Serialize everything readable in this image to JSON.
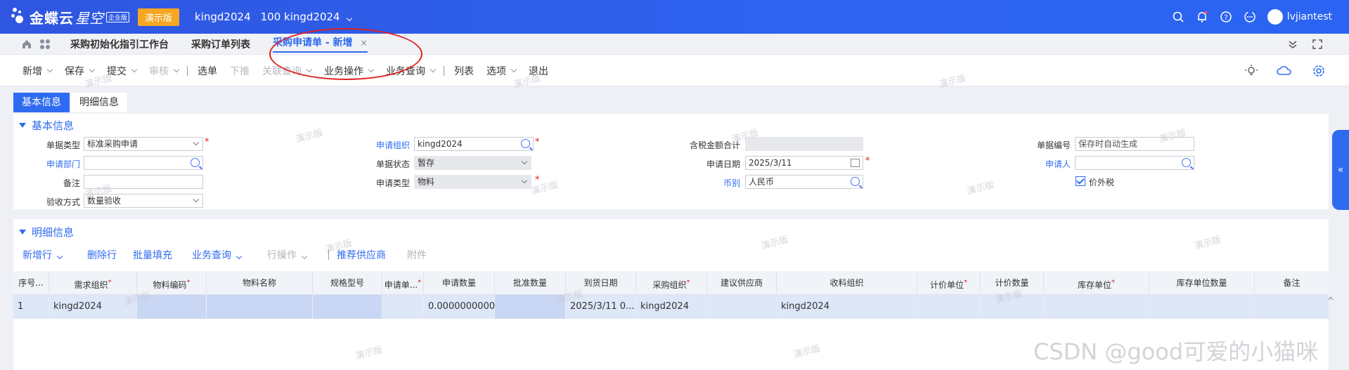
{
  "topbar": {
    "logo_main": "金蝶云",
    "logo_sub": "星空",
    "edition_badge": "企业版",
    "demo_badge": "演示版",
    "org": "kingd2024",
    "org_full": "100 kingd2024",
    "username": "lvjiantest"
  },
  "tabs": [
    {
      "label": "采购初始化指引工作台"
    },
    {
      "label": "采购订单列表"
    },
    {
      "label": "采购申请单 - 新增"
    }
  ],
  "toolbar": [
    {
      "label": "新增",
      "dropdown": true,
      "disabled": false
    },
    {
      "label": "保存",
      "dropdown": true,
      "disabled": false
    },
    {
      "label": "提交",
      "dropdown": true,
      "disabled": false
    },
    {
      "label": "审核",
      "dropdown": true,
      "disabled": true
    },
    {
      "label": "选单",
      "dropdown": false,
      "disabled": false
    },
    {
      "label": "下推",
      "dropdown": false,
      "disabled": true
    },
    {
      "label": "关联查询",
      "dropdown": true,
      "disabled": true
    },
    {
      "label": "业务操作",
      "dropdown": true,
      "disabled": false
    },
    {
      "label": "业务查询",
      "dropdown": true,
      "disabled": false
    },
    {
      "label": "列表",
      "dropdown": false,
      "disabled": false
    },
    {
      "label": "选项",
      "dropdown": true,
      "disabled": false
    },
    {
      "label": "退出",
      "dropdown": false,
      "disabled": false
    }
  ],
  "subtabs": {
    "basic": "基本信息",
    "detail": "明细信息"
  },
  "basic": {
    "title": "基本信息",
    "bill_type": {
      "label": "单据类型",
      "value": "标准采购申请"
    },
    "apply_dept": {
      "label": "申请部门",
      "value": ""
    },
    "remark": {
      "label": "备注",
      "value": ""
    },
    "accept_method": {
      "label": "验收方式",
      "value": "数量验收"
    },
    "apply_org": {
      "label": "申请组织",
      "value": "kingd2024"
    },
    "bill_status": {
      "label": "单据状态",
      "value": "暂存"
    },
    "apply_type": {
      "label": "申请类型",
      "value": "物料"
    },
    "tax_total": {
      "label": "含税金额合计",
      "value": ""
    },
    "apply_date": {
      "label": "申请日期",
      "value": "2025/3/11"
    },
    "currency": {
      "label": "币别",
      "value": "人民币"
    },
    "bill_no": {
      "label": "单据编号",
      "value": "保存时自动生成"
    },
    "applicant": {
      "label": "申请人",
      "value": ""
    },
    "price_excl_tax": {
      "label": "价外税",
      "checked": true
    }
  },
  "detail": {
    "title": "明细信息",
    "tools": [
      {
        "label": "新增行",
        "dropdown": true,
        "disabled": false
      },
      {
        "label": "删除行",
        "dropdown": false,
        "disabled": false
      },
      {
        "label": "批量填充",
        "dropdown": false,
        "disabled": false
      },
      {
        "label": "业务查询",
        "dropdown": true,
        "disabled": false
      },
      {
        "label": "行操作",
        "dropdown": true,
        "disabled": true
      },
      {
        "label": "推荐供应商",
        "dropdown": false,
        "disabled": false
      },
      {
        "label": "附件",
        "dropdown": false,
        "disabled": true
      }
    ],
    "columns": [
      "序号...",
      "需求组织",
      "物料编码",
      "物料名称",
      "规格型号",
      "申请单...",
      "申请数量",
      "批准数量",
      "到货日期",
      "采购组织",
      "建议供应商",
      "收料组织",
      "计价单位",
      "计价数量",
      "库存单位",
      "库存单位数量",
      "备注"
    ],
    "rows": [
      [
        "1",
        "kingd2024",
        "",
        "",
        "",
        "",
        "0.0000000000",
        "",
        "2025/3/11 0...",
        "kingd2024",
        "",
        "kingd2024",
        "",
        "",
        "",
        "",
        ""
      ]
    ]
  },
  "watermark": "演示版",
  "csdn_mark": "CSDN @good可爱的小猫咪"
}
